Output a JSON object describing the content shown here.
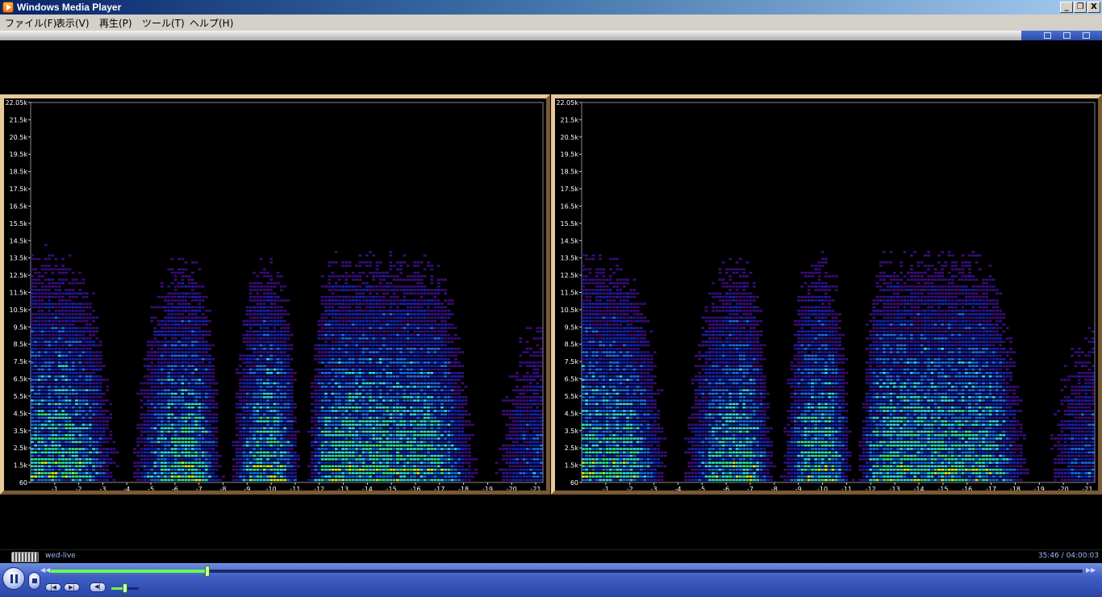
{
  "window": {
    "title": "Windows Media Player",
    "minimize": "_",
    "restore": "❐",
    "close": "X"
  },
  "menu": {
    "items": [
      "ファイル(F)",
      "表示(V)",
      "再生(P)",
      "ツール(T)",
      "ヘルプ(H)"
    ]
  },
  "visualization": {
    "y_ticks": [
      "22.05k",
      "21.5k",
      "20.5k",
      "19.5k",
      "18.5k",
      "17.5k",
      "16.5k",
      "15.5k",
      "14.5k",
      "13.5k",
      "12.5k",
      "11.5k",
      "10.5k",
      "9.5k",
      "8.5k",
      "7.5k",
      "6.5k",
      "5.5k",
      "4.5k",
      "3.5k",
      "2.5k",
      "1.5k",
      "60"
    ],
    "x_ticks": [
      "-1",
      "-2",
      "-3",
      "-4",
      "-5",
      "-6",
      "-7",
      "-8",
      "-9",
      "-10",
      "-11",
      "-12",
      "-13",
      "-14",
      "-15",
      "-16",
      "-17",
      "-18",
      "-19",
      "-20",
      "-21"
    ],
    "channels": 2,
    "colors": {
      "frame": "#b89364",
      "low": "#0a18a0",
      "mid": "#2fd7e8",
      "high": "#d8f020"
    }
  },
  "status": {
    "track": "wed-live",
    "time": "35:46 / 04:00:03"
  },
  "playback": {
    "seek_fraction": 0.152,
    "volume_fraction": 0.5,
    "pause_icon": "pause-icon",
    "stop_icon": "stop-icon",
    "mute_label": "◀|"
  }
}
